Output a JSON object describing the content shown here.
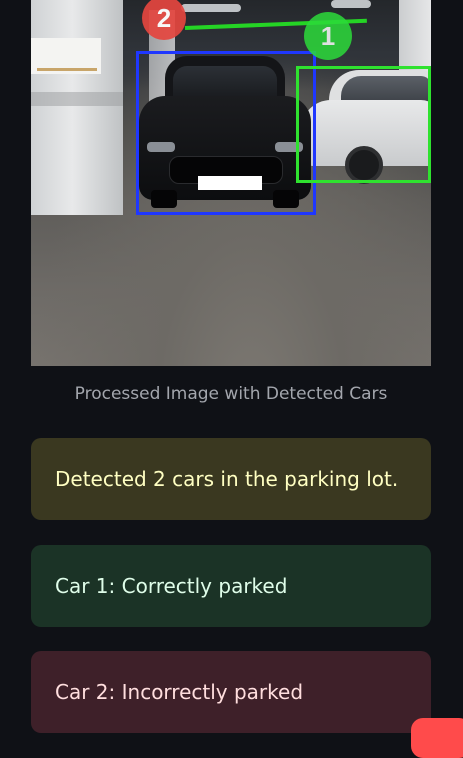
{
  "image": {
    "caption": "Processed Image with Detected Cars",
    "markers": [
      {
        "label": "2",
        "color": "#e4463f"
      },
      {
        "label": "1",
        "color": "#2cdb3a"
      }
    ],
    "box_colors": {
      "car_2": "#1f37ff",
      "car_1": "#2fe22f"
    }
  },
  "alerts": {
    "summary": "Detected 2 cars in the parking lot.",
    "car1": "Car 1: Correctly parked",
    "car2": "Car 2: Incorrectly parked"
  },
  "colors": {
    "background": "#0f1116",
    "warning_bg": "#3a3820",
    "success_bg": "#1b3326",
    "error_bg": "#3e2029",
    "accent": "#ff4b4b"
  }
}
